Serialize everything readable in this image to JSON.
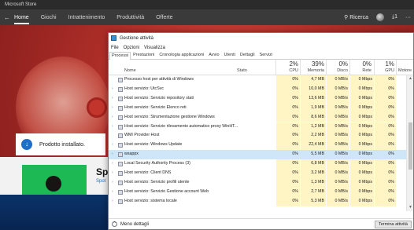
{
  "store": {
    "window_title": "Microsoft Store",
    "nav": [
      "Home",
      "Giochi",
      "Intrattenimento",
      "Produttività",
      "Offerte"
    ],
    "search_label": "Ricerca",
    "downloads_count": "1",
    "more": "···",
    "installed_text": "Prodotto installato.",
    "app_name": "Spo",
    "app_publisher": "Spot"
  },
  "taskmgr": {
    "title": "Gestione attività",
    "menu": [
      "File",
      "Opzioni",
      "Visualizza"
    ],
    "tabs": [
      "Processi",
      "Prestazioni",
      "Cronologia applicazioni",
      "Avvio",
      "Utenti",
      "Dettagli",
      "Servizi"
    ],
    "active_tab": "Processi",
    "headers": {
      "name": "Nome",
      "status": "Stato",
      "cpu_pct": "2%",
      "cpu": "CPU",
      "mem_pct": "39%",
      "mem": "Memoria",
      "disk_pct": "0%",
      "disk": "Disco",
      "net_pct": "0%",
      "net": "Rete",
      "gpu_pct": "1%",
      "gpu": "GPU",
      "engine": "Motore"
    },
    "rows": [
      {
        "name": "Processo host per attività di Windows",
        "expand": false,
        "cpu": "0%",
        "mem": "4,7 MB",
        "disk": "0 MB/s",
        "net": "0 Mbps",
        "gpu": "0%"
      },
      {
        "name": "Host servizio: UtcSvc",
        "expand": true,
        "cpu": "0%",
        "mem": "10,0 MB",
        "disk": "0 MB/s",
        "net": "0 Mbps",
        "gpu": "0%"
      },
      {
        "name": "Host servizio: Servizio repository stati",
        "expand": true,
        "cpu": "0%",
        "mem": "13,6 MB",
        "disk": "0 MB/s",
        "net": "0 Mbps",
        "gpu": "0%"
      },
      {
        "name": "Host servizio: Servizio Elenco reti",
        "expand": true,
        "cpu": "0%",
        "mem": "1,9 MB",
        "disk": "0 MB/s",
        "net": "0 Mbps",
        "gpu": "0%"
      },
      {
        "name": "Host servizio: Strumentazione gestione Windows",
        "expand": true,
        "cpu": "0%",
        "mem": "8,6 MB",
        "disk": "0 MB/s",
        "net": "0 Mbps",
        "gpu": "0%"
      },
      {
        "name": "Host servizio: Servizio rilevamento automatico proxy WinHT...",
        "expand": true,
        "cpu": "0%",
        "mem": "1,2 MB",
        "disk": "0 MB/s",
        "net": "0 Mbps",
        "gpu": "0%"
      },
      {
        "name": "WMI Provider Host",
        "expand": false,
        "cpu": "0%",
        "mem": "2,2 MB",
        "disk": "0 MB/s",
        "net": "0 Mbps",
        "gpu": "0%"
      },
      {
        "name": "Host servizio: Windows Update",
        "expand": true,
        "cpu": "0%",
        "mem": "22,4 MB",
        "disk": "0 MB/s",
        "net": "0 Mbps",
        "gpu": "0%"
      },
      {
        "name": "wsappx",
        "expand": true,
        "cpu": "0%",
        "mem": "5,5 MB",
        "disk": "0 MB/s",
        "net": "0 Mbps",
        "gpu": "0%",
        "selected": true
      },
      {
        "name": "Local Security Authority Process (3)",
        "expand": true,
        "cpu": "0%",
        "mem": "6,8 MB",
        "disk": "0 MB/s",
        "net": "0 Mbps",
        "gpu": "0%"
      },
      {
        "name": "Host servizio: Client DNS",
        "expand": true,
        "cpu": "0%",
        "mem": "3,2 MB",
        "disk": "0 MB/s",
        "net": "0 Mbps",
        "gpu": "0%"
      },
      {
        "name": "Host servizio: Servizio profili utente",
        "expand": true,
        "cpu": "0%",
        "mem": "1,3 MB",
        "disk": "0 MB/s",
        "net": "0 Mbps",
        "gpu": "0%"
      },
      {
        "name": "Host servizio: Servizio Gestione account Web",
        "expand": true,
        "cpu": "0%",
        "mem": "2,7 MB",
        "disk": "0 MB/s",
        "net": "0 Mbps",
        "gpu": "0%"
      },
      {
        "name": "Host servizio: sistema locale",
        "expand": true,
        "cpu": "0%",
        "mem": "5,3 MB",
        "disk": "0 MB/s",
        "net": "0 Mbps",
        "gpu": "0%"
      }
    ],
    "footer_less": "Meno dettagli",
    "end_task": "Termina attività"
  }
}
